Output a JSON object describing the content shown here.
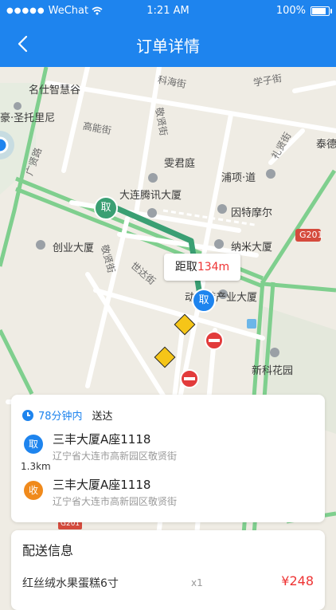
{
  "status_bar": {
    "signal": "●●●●●",
    "carrier": "WeChat",
    "time": "1:21 AM",
    "battery": "100%",
    "battery_level": 1.0
  },
  "nav": {
    "title": "订单详情"
  },
  "map": {
    "pois": [
      "名仕智慧谷",
      "豪·圣托里尼",
      "雯君庭",
      "浦项·道",
      "大连腾讯大厦",
      "因特摩尔",
      "创业大厦",
      "纳米大厦",
      "动漫游产业大厦",
      "新科花园",
      "泰德"
    ],
    "roads": [
      "科海街",
      "学子街",
      "高能街",
      "敬贤街",
      "礼贤街",
      "广贤路",
      "敬贤街",
      "世达街",
      "G201",
      "G201"
    ],
    "pickup_pin": "取",
    "pickup_pin2": "取",
    "distance_label": "距取",
    "distance_value": "134m"
  },
  "order": {
    "eta_time": "78分钟内",
    "eta_suffix": "送达",
    "pickup": {
      "badge": "取",
      "name": "三丰大厦A座1118",
      "address": "辽宁省大连市高新园区敬贤街"
    },
    "distance": "1.3km",
    "delivery": {
      "badge": "收",
      "name": "三丰大厦A座1118",
      "address": "辽宁省大连市高新园区敬贤街"
    }
  },
  "delivery_info": {
    "title": "配送信息",
    "items": [
      {
        "name": "红丝绒水果蛋糕6寸",
        "qty": "x1",
        "price": "¥248"
      }
    ]
  },
  "colors": {
    "primary": "#1e84ee",
    "pickup_green": "#3a9f73",
    "delivery_orange": "#f08a1c",
    "price_red": "#e33333"
  }
}
